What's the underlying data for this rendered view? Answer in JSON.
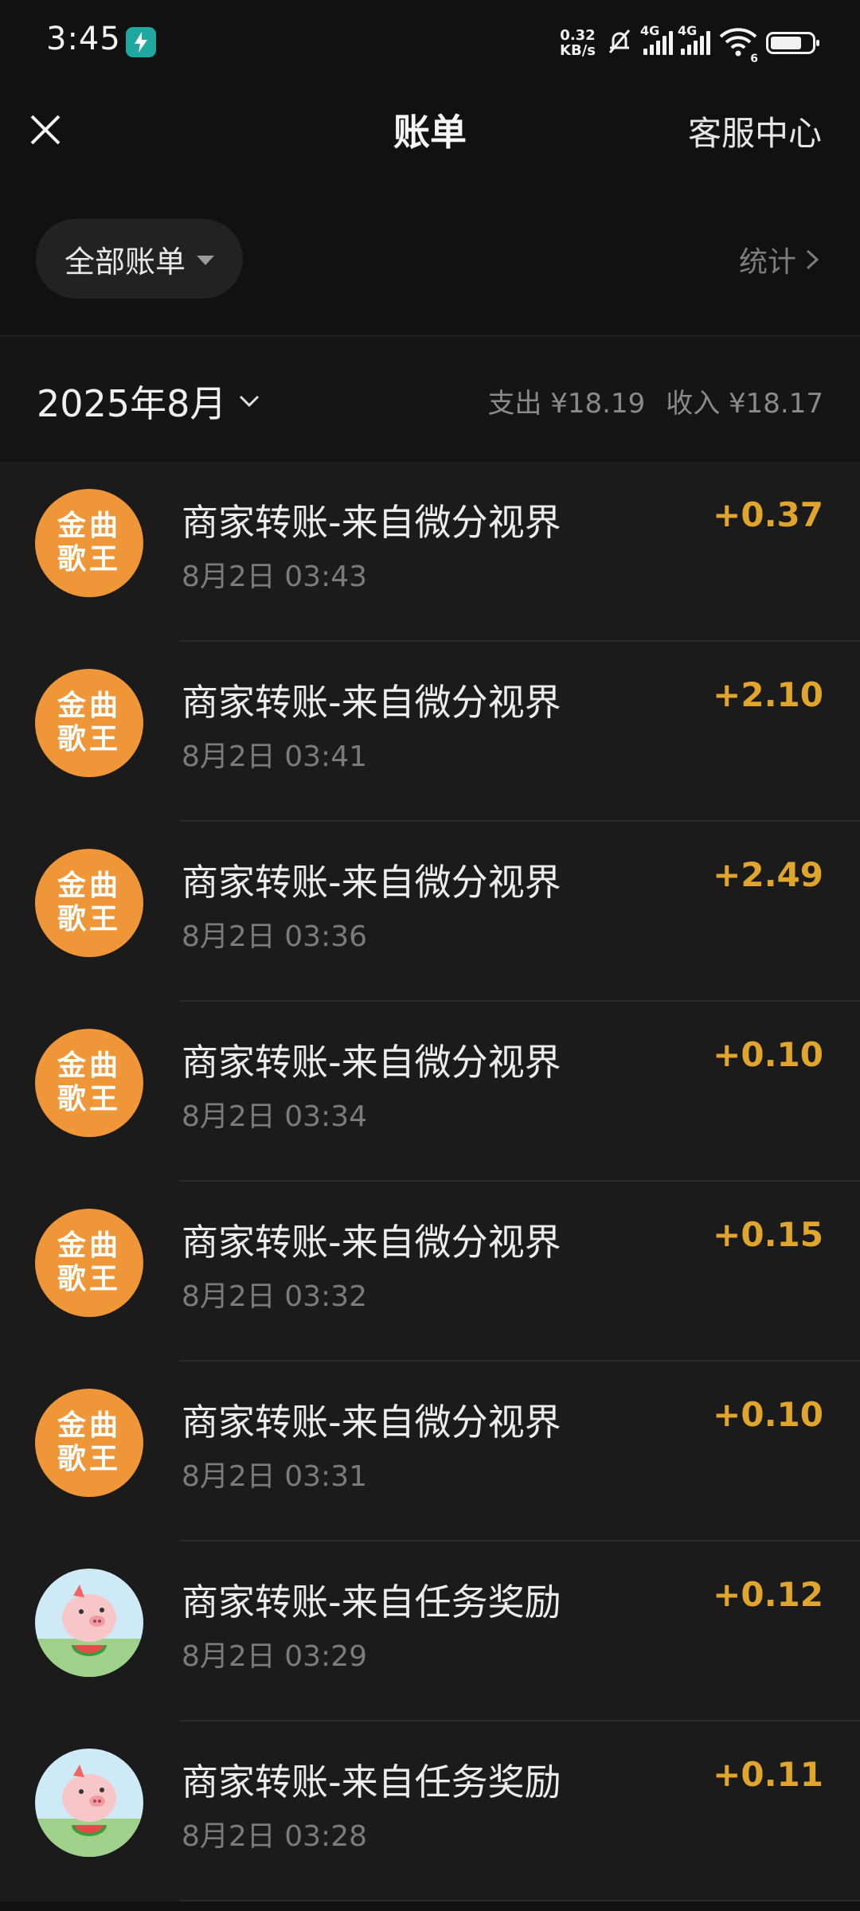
{
  "status_bar": {
    "time": "3:45",
    "net_speed_value": "0.32",
    "net_speed_unit": "KB/s",
    "network_1": "4G",
    "network_2": "4G",
    "wifi_sub": "6",
    "battery_level": 0.75
  },
  "header": {
    "title": "账单",
    "service_link": "客服中心"
  },
  "filter": {
    "selected": "全部账单",
    "stats_link": "统计"
  },
  "month": {
    "label": "2025年8月",
    "expense": "支出 ¥18.19",
    "income": "收入 ¥18.17"
  },
  "colors": {
    "accent_amount": "#e0a52c",
    "avatar_orange": "#ef9738",
    "background": "#111111"
  },
  "transactions": [
    {
      "avatar": "text",
      "avatar_line1": "金曲",
      "avatar_line2": "歌王",
      "title": "商家转账-来自微分视界",
      "time": "8月2日 03:43",
      "amount": "+0.37"
    },
    {
      "avatar": "text",
      "avatar_line1": "金曲",
      "avatar_line2": "歌王",
      "title": "商家转账-来自微分视界",
      "time": "8月2日 03:41",
      "amount": "+2.10"
    },
    {
      "avatar": "text",
      "avatar_line1": "金曲",
      "avatar_line2": "歌王",
      "title": "商家转账-来自微分视界",
      "time": "8月2日 03:36",
      "amount": "+2.49"
    },
    {
      "avatar": "text",
      "avatar_line1": "金曲",
      "avatar_line2": "歌王",
      "title": "商家转账-来自微分视界",
      "time": "8月2日 03:34",
      "amount": "+0.10"
    },
    {
      "avatar": "text",
      "avatar_line1": "金曲",
      "avatar_line2": "歌王",
      "title": "商家转账-来自微分视界",
      "time": "8月2日 03:32",
      "amount": "+0.15"
    },
    {
      "avatar": "text",
      "avatar_line1": "金曲",
      "avatar_line2": "歌王",
      "title": "商家转账-来自微分视界",
      "time": "8月2日 03:31",
      "amount": "+0.10"
    },
    {
      "avatar": "pig-watermelon-icon",
      "title": "商家转账-来自任务奖励",
      "time": "8月2日 03:29",
      "amount": "+0.12"
    },
    {
      "avatar": "pig-watermelon-icon",
      "title": "商家转账-来自任务奖励",
      "time": "8月2日 03:28",
      "amount": "+0.11"
    }
  ]
}
